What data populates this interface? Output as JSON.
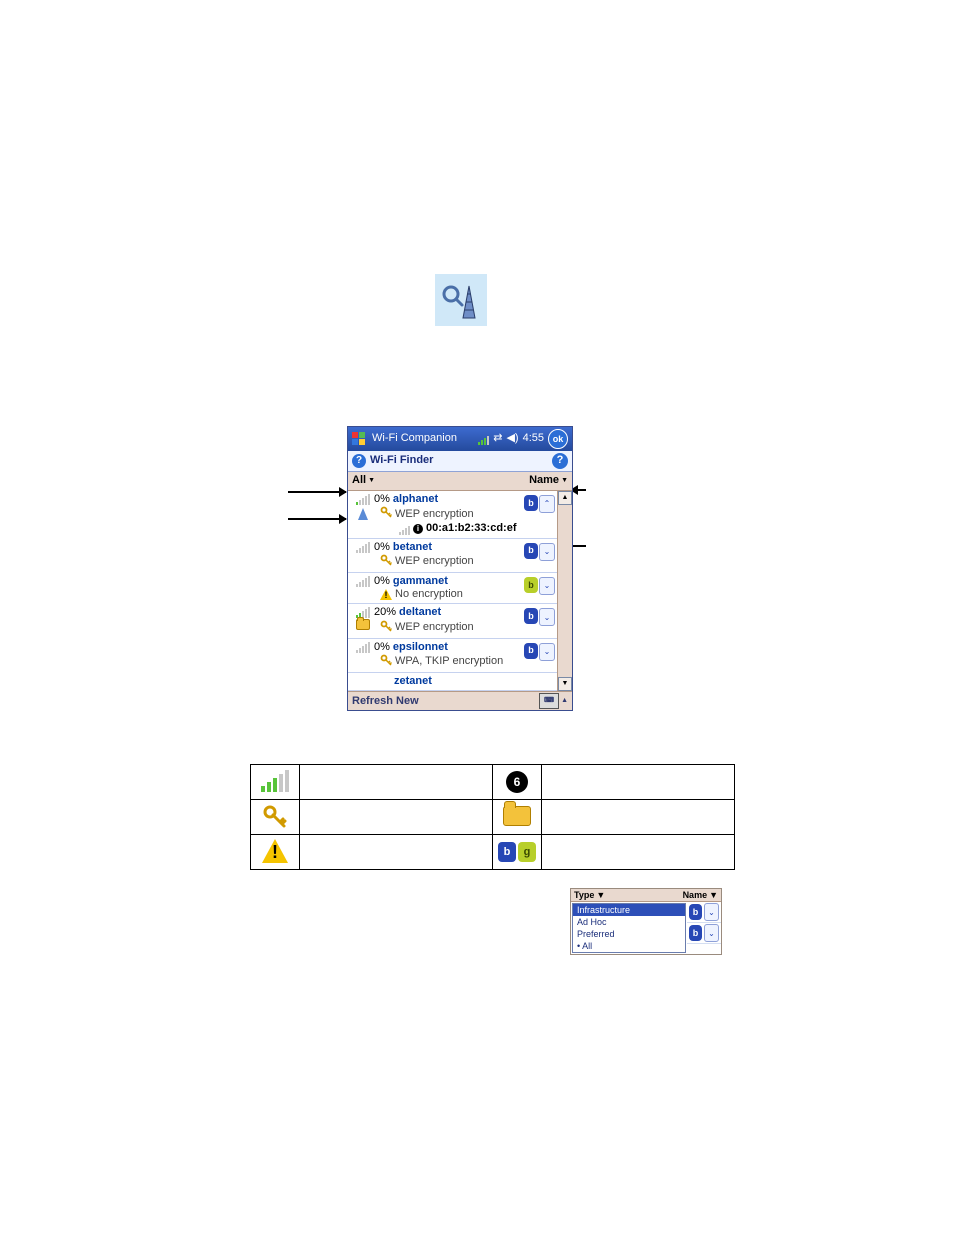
{
  "top_icon": "wifi-finder-search-tower-icon",
  "device": {
    "status": {
      "app": "Wi-Fi Companion",
      "time": "4:55",
      "ok": "ok"
    },
    "subheader_title": "Wi-Fi Finder",
    "filter": {
      "left": "All",
      "right": "Name"
    },
    "networks": [
      {
        "signal_on": 1,
        "pct": "0%",
        "name": "alphanet",
        "enc": "WEP encryption",
        "enc_icon": "key",
        "left_icon": "tower",
        "badge": "blue",
        "chev": "up",
        "mac": "00:a1:b2:33:cd:ef"
      },
      {
        "signal_on": 0,
        "pct": "0%",
        "name": "betanet",
        "enc": "WEP encryption",
        "enc_icon": "key",
        "badge": "blue",
        "chev": "down"
      },
      {
        "signal_on": 0,
        "pct": "0%",
        "name": "gammanet",
        "enc": "No encryption",
        "enc_icon": "warn",
        "badge": "green",
        "chev": "down"
      },
      {
        "signal_on": 2,
        "pct": "20%",
        "name": "deltanet",
        "enc": "WEP encryption",
        "enc_icon": "key",
        "left_icon": "folder",
        "badge": "blue",
        "chev": "down"
      },
      {
        "signal_on": 0,
        "pct": "0%",
        "name": "epsilonnet",
        "enc": "WPA, TKIP encryption",
        "enc_icon": "key",
        "badge": "blue",
        "chev": "down"
      },
      {
        "name_only": "zetanet"
      }
    ],
    "bottom": {
      "left": "Refresh",
      "right": "New"
    }
  },
  "legend": {
    "rows": [
      {
        "icon1": "signal",
        "icon2": "channel",
        "chan": "6"
      },
      {
        "icon1": "key",
        "icon2": "folder"
      },
      {
        "icon1": "warn",
        "icon2": "bg-pair"
      }
    ]
  },
  "mini": {
    "bar": {
      "left": "Type",
      "right": "Name"
    },
    "menu": [
      "Infrastructure",
      "Ad Hoc",
      "Preferred",
      "• All"
    ],
    "selected": 0
  }
}
